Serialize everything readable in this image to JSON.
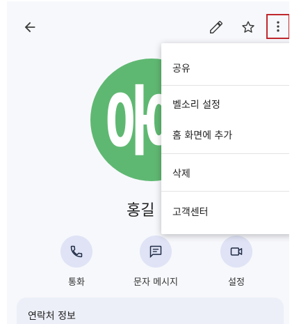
{
  "header": {
    "back_icon": "arrow-left-icon",
    "edit_icon": "pencil-icon",
    "star_icon": "star-outline-icon",
    "more_icon": "more-vert-icon"
  },
  "contact": {
    "avatar_letter": "홍",
    "avatar_color": "#5fb872",
    "name": "홍길"
  },
  "actions": [
    {
      "label": "통화",
      "icon": "phone-icon"
    },
    {
      "label": "문자 메시지",
      "icon": "message-icon"
    },
    {
      "label": "설정",
      "icon": "video-call-icon"
    }
  ],
  "info_card": {
    "title": "연락처 정보"
  },
  "menu": {
    "items": [
      "공유",
      "벨소리 설정",
      "홈 화면에 추가",
      "삭제",
      "고객센터"
    ]
  },
  "colors": {
    "accent_highlight": "#c0272d",
    "action_bg": "#dfe3f5"
  }
}
